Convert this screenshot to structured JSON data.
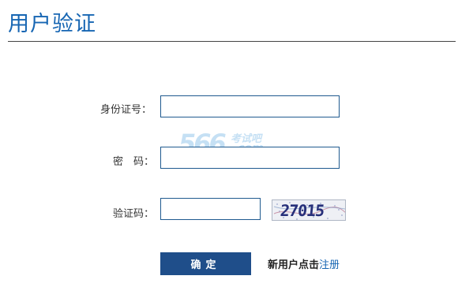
{
  "page": {
    "title": "用户验证"
  },
  "form": {
    "id_label": "身份证号：",
    "id_value": "",
    "password_label": "密　码：",
    "password_value": "",
    "captcha_label": "验证码：",
    "captcha_value": "",
    "captcha_image_text": "27015",
    "submit_label": "确定"
  },
  "register": {
    "prefix": "新用户点击",
    "link_label": "注册"
  },
  "watermark": {
    "number": "566",
    "site_cn": "考试吧",
    "site_en": ".com"
  },
  "colors": {
    "title": "#1766b3",
    "button": "#1f4e8a",
    "input_border": "#1f5a8f",
    "link": "#1766b3"
  }
}
